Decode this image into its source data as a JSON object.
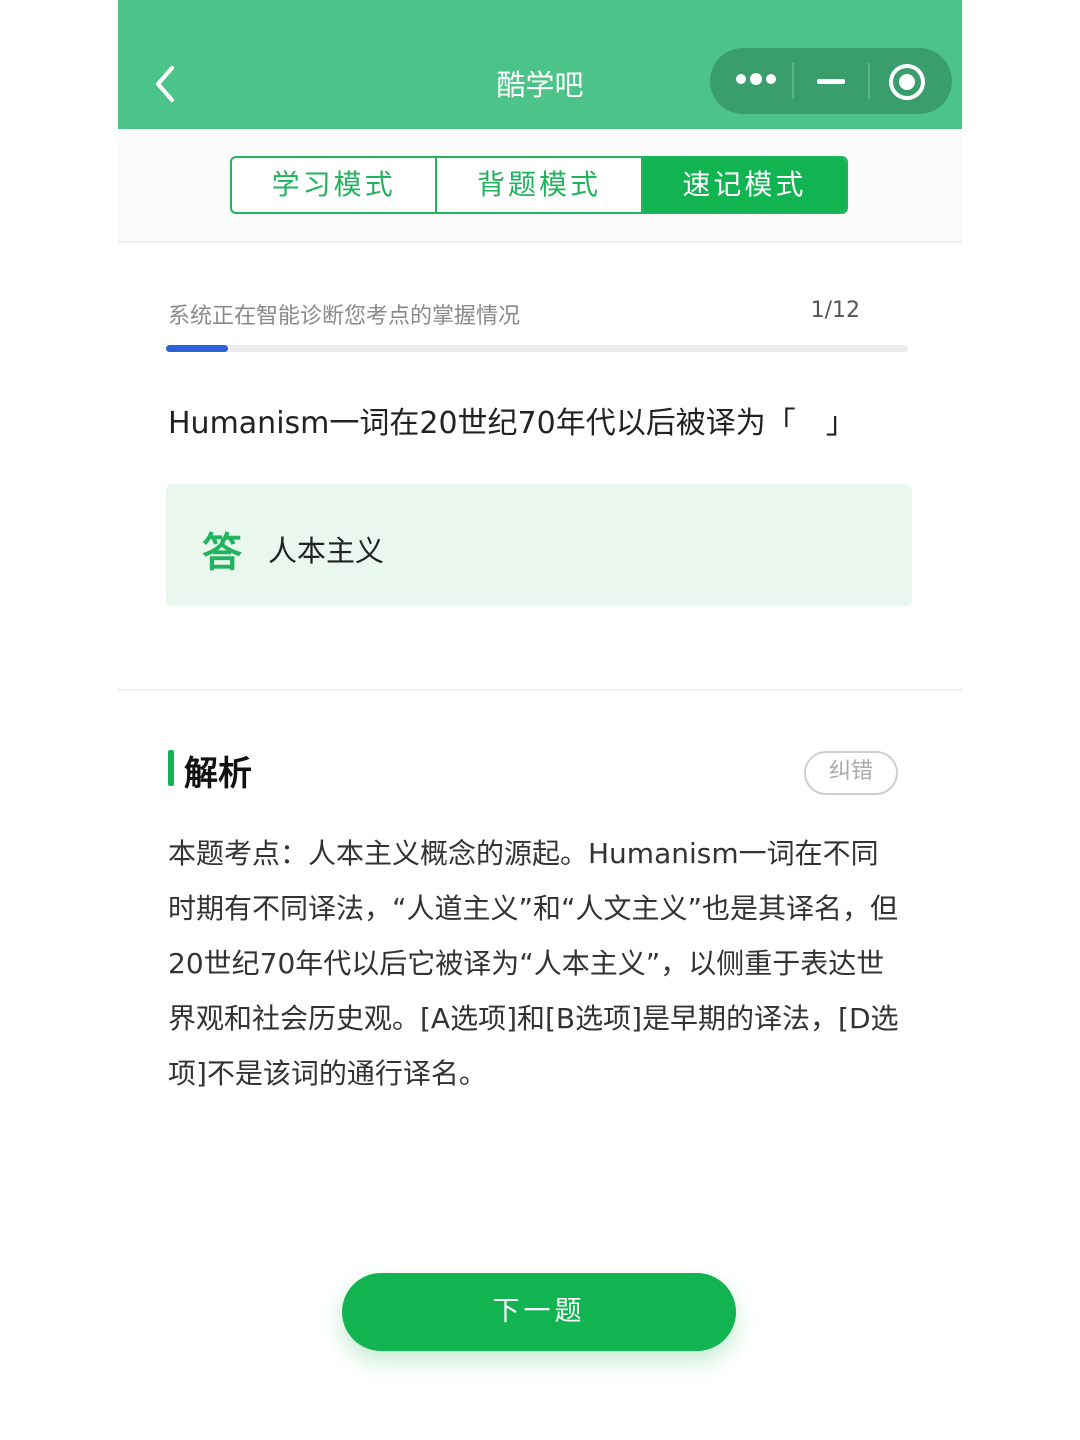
{
  "header": {
    "title": "酷学吧",
    "back_icon": "chevron-left-icon",
    "capsule_icons": [
      "more-dots-icon",
      "minimize-icon",
      "target-icon"
    ]
  },
  "tabs": [
    {
      "label": "学习模式",
      "active": false
    },
    {
      "label": "背题模式",
      "active": false
    },
    {
      "label": "速记模式",
      "active": true
    }
  ],
  "progress": {
    "status_text": "系统正在智能诊断您考点的掌握情况",
    "counter": "1/12",
    "current": 1,
    "total": 12,
    "bar_color": "#2f61d6"
  },
  "question": {
    "text": "Humanism一词在20世纪70年代以后被译为「　」"
  },
  "answer": {
    "label": "答",
    "text": "人本主义"
  },
  "analysis": {
    "title": "解析",
    "report_label": "纠错",
    "text": "本题考点：人本主义概念的源起。Humanism一词在不同时期有不同译法，“人道主义”和“人文主义”也是其译名，但20世纪70年代以后它被译为“人本主义”，以侧重于表达世界观和社会历史观。[A选项]和[B选项]是早期的译法，[D选项]不是该词的通行译名。"
  },
  "footer": {
    "next_label": "下一题"
  },
  "colors": {
    "header": "#4cc388",
    "accent": "#12b451",
    "answer_bg": "#e9f7ee"
  }
}
